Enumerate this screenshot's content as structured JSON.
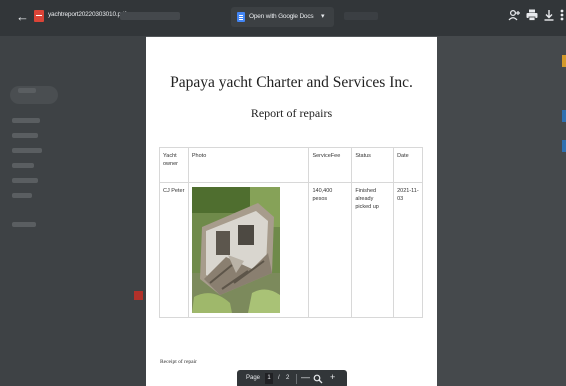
{
  "toolbar": {
    "back_glyph": "←",
    "file_name": "yachtreport20220303010.pdf",
    "open_with_label": "Open with Google Docs",
    "open_with_caret": "▾",
    "icons": [
      "back-arrow-icon",
      "pdf-file-icon",
      "google-docs-icon",
      "add-person-icon",
      "printer-icon",
      "download-icon",
      "more-vert-icon"
    ]
  },
  "document": {
    "title": "Papaya yacht Charter and Services Inc.",
    "subtitle": "Report of repairs",
    "table": {
      "headers": [
        "Yacht owner",
        "Photo",
        "ServiceFee",
        "Status",
        "Date"
      ],
      "rows": [
        {
          "owner": "CJ Peter",
          "photo": "photo",
          "fee": "140,400 pesos",
          "status": "Finished already picked up",
          "date": "2021-11-03"
        }
      ]
    },
    "footer_text": "Receipt of repair"
  },
  "pagebar": {
    "label": "Page",
    "current": "1",
    "separator": "/",
    "total": "2",
    "zoom_out": "—",
    "zoom_in": "+"
  },
  "colors": {
    "toolbar": "#323639",
    "viewer_bg": "#525659",
    "pdf_red": "#db4437",
    "docs_blue": "#4285f4"
  }
}
